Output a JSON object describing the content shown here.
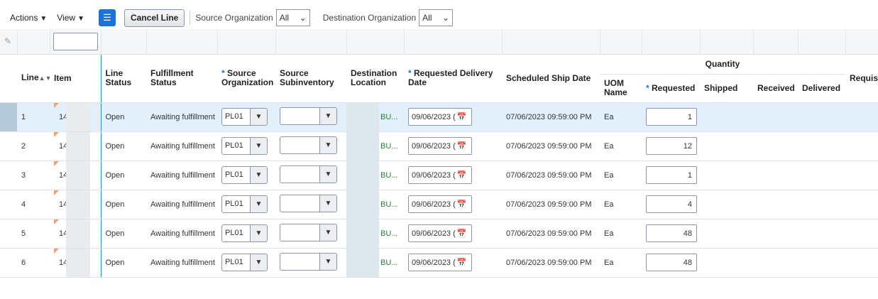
{
  "toolbar": {
    "actions": "Actions",
    "view": "View",
    "cancel_line": "Cancel Line",
    "source_org_label": "Source Organization",
    "source_org_value": "All",
    "dest_org_label": "Destination Organization",
    "dest_org_value": "All"
  },
  "headers": {
    "line": "Line",
    "item": "Item",
    "line_status": "Line Status",
    "fulfillment_status": "Fulfillment Status",
    "source_org": "Source Organization",
    "source_subinv": "Source Subinventory",
    "dest_location": "Destination Location",
    "req_delivery": "Requested Delivery Date",
    "sched_ship": "Scheduled Ship Date",
    "quantity": "Quantity",
    "uom": "UOM Name",
    "requested": "Requested",
    "shipped": "Shipped",
    "received": "Received",
    "delivered": "Delivered",
    "requis": "Requisi",
    "required_mark": "*"
  },
  "rows": [
    {
      "line": "1",
      "item": "14",
      "status": "Open",
      "fulfillment": "Awaiting fulfillment",
      "source_org": "PL01",
      "subinv": "",
      "dest": "BU...",
      "req_date": "09/06/2023 (",
      "sched": "07/06/2023 09:59:00 PM",
      "uom": "Ea",
      "qty": "1"
    },
    {
      "line": "2",
      "item": "14",
      "status": "Open",
      "fulfillment": "Awaiting fulfillment",
      "source_org": "PL01",
      "subinv": "",
      "dest": "BU...",
      "req_date": "09/06/2023 (",
      "sched": "07/06/2023 09:59:00 PM",
      "uom": "Ea",
      "qty": "12"
    },
    {
      "line": "3",
      "item": "14",
      "status": "Open",
      "fulfillment": "Awaiting fulfillment",
      "source_org": "PL01",
      "subinv": "",
      "dest": "BU...",
      "req_date": "09/06/2023 (",
      "sched": "07/06/2023 09:59:00 PM",
      "uom": "Ea",
      "qty": "1"
    },
    {
      "line": "4",
      "item": "14",
      "status": "Open",
      "fulfillment": "Awaiting fulfillment",
      "source_org": "PL01",
      "subinv": "",
      "dest": "BU...",
      "req_date": "09/06/2023 (",
      "sched": "07/06/2023 09:59:00 PM",
      "uom": "Ea",
      "qty": "4"
    },
    {
      "line": "5",
      "item": "14",
      "status": "Open",
      "fulfillment": "Awaiting fulfillment",
      "source_org": "PL01",
      "subinv": "",
      "dest": "BU...",
      "req_date": "09/06/2023 (",
      "sched": "07/06/2023 09:59:00 PM",
      "uom": "Ea",
      "qty": "48"
    },
    {
      "line": "6",
      "item": "14",
      "status": "Open",
      "fulfillment": "Awaiting fulfillment",
      "source_org": "PL01",
      "subinv": "",
      "dest": "BU...",
      "req_date": "09/06/2023 (",
      "sched": "07/06/2023 09:59:00 PM",
      "uom": "Ea",
      "qty": "48"
    }
  ]
}
